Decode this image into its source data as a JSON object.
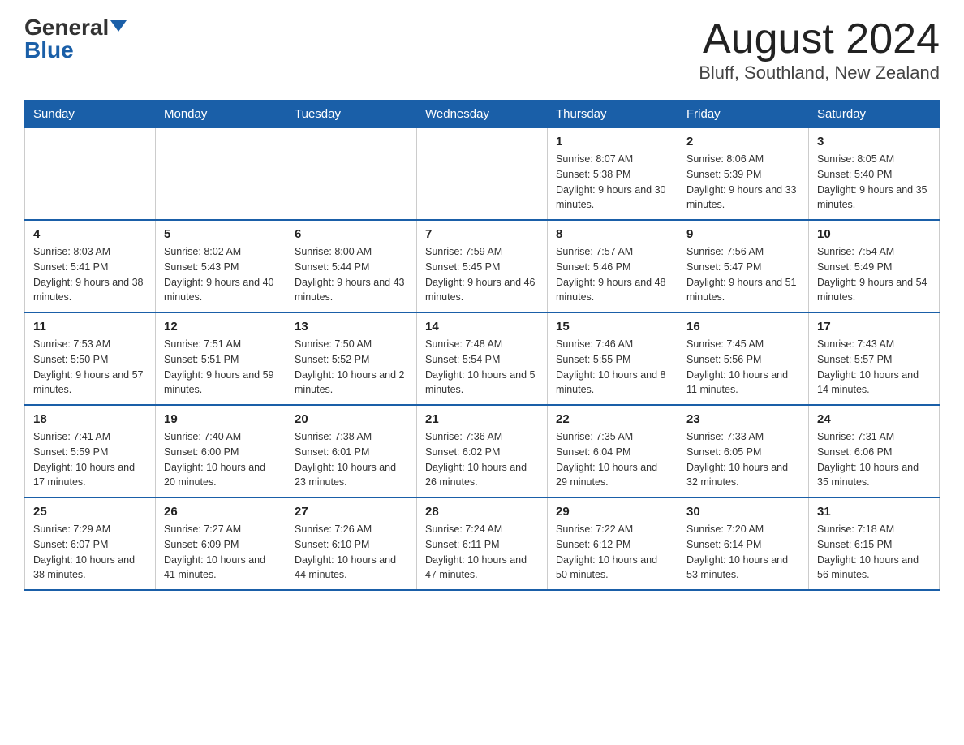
{
  "logo": {
    "general": "General",
    "blue": "Blue"
  },
  "title": "August 2024",
  "subtitle": "Bluff, Southland, New Zealand",
  "days_of_week": [
    "Sunday",
    "Monday",
    "Tuesday",
    "Wednesday",
    "Thursday",
    "Friday",
    "Saturday"
  ],
  "weeks": [
    [
      {
        "day": "",
        "info": ""
      },
      {
        "day": "",
        "info": ""
      },
      {
        "day": "",
        "info": ""
      },
      {
        "day": "",
        "info": ""
      },
      {
        "day": "1",
        "info": "Sunrise: 8:07 AM\nSunset: 5:38 PM\nDaylight: 9 hours and 30 minutes."
      },
      {
        "day": "2",
        "info": "Sunrise: 8:06 AM\nSunset: 5:39 PM\nDaylight: 9 hours and 33 minutes."
      },
      {
        "day": "3",
        "info": "Sunrise: 8:05 AM\nSunset: 5:40 PM\nDaylight: 9 hours and 35 minutes."
      }
    ],
    [
      {
        "day": "4",
        "info": "Sunrise: 8:03 AM\nSunset: 5:41 PM\nDaylight: 9 hours and 38 minutes."
      },
      {
        "day": "5",
        "info": "Sunrise: 8:02 AM\nSunset: 5:43 PM\nDaylight: 9 hours and 40 minutes."
      },
      {
        "day": "6",
        "info": "Sunrise: 8:00 AM\nSunset: 5:44 PM\nDaylight: 9 hours and 43 minutes."
      },
      {
        "day": "7",
        "info": "Sunrise: 7:59 AM\nSunset: 5:45 PM\nDaylight: 9 hours and 46 minutes."
      },
      {
        "day": "8",
        "info": "Sunrise: 7:57 AM\nSunset: 5:46 PM\nDaylight: 9 hours and 48 minutes."
      },
      {
        "day": "9",
        "info": "Sunrise: 7:56 AM\nSunset: 5:47 PM\nDaylight: 9 hours and 51 minutes."
      },
      {
        "day": "10",
        "info": "Sunrise: 7:54 AM\nSunset: 5:49 PM\nDaylight: 9 hours and 54 minutes."
      }
    ],
    [
      {
        "day": "11",
        "info": "Sunrise: 7:53 AM\nSunset: 5:50 PM\nDaylight: 9 hours and 57 minutes."
      },
      {
        "day": "12",
        "info": "Sunrise: 7:51 AM\nSunset: 5:51 PM\nDaylight: 9 hours and 59 minutes."
      },
      {
        "day": "13",
        "info": "Sunrise: 7:50 AM\nSunset: 5:52 PM\nDaylight: 10 hours and 2 minutes."
      },
      {
        "day": "14",
        "info": "Sunrise: 7:48 AM\nSunset: 5:54 PM\nDaylight: 10 hours and 5 minutes."
      },
      {
        "day": "15",
        "info": "Sunrise: 7:46 AM\nSunset: 5:55 PM\nDaylight: 10 hours and 8 minutes."
      },
      {
        "day": "16",
        "info": "Sunrise: 7:45 AM\nSunset: 5:56 PM\nDaylight: 10 hours and 11 minutes."
      },
      {
        "day": "17",
        "info": "Sunrise: 7:43 AM\nSunset: 5:57 PM\nDaylight: 10 hours and 14 minutes."
      }
    ],
    [
      {
        "day": "18",
        "info": "Sunrise: 7:41 AM\nSunset: 5:59 PM\nDaylight: 10 hours and 17 minutes."
      },
      {
        "day": "19",
        "info": "Sunrise: 7:40 AM\nSunset: 6:00 PM\nDaylight: 10 hours and 20 minutes."
      },
      {
        "day": "20",
        "info": "Sunrise: 7:38 AM\nSunset: 6:01 PM\nDaylight: 10 hours and 23 minutes."
      },
      {
        "day": "21",
        "info": "Sunrise: 7:36 AM\nSunset: 6:02 PM\nDaylight: 10 hours and 26 minutes."
      },
      {
        "day": "22",
        "info": "Sunrise: 7:35 AM\nSunset: 6:04 PM\nDaylight: 10 hours and 29 minutes."
      },
      {
        "day": "23",
        "info": "Sunrise: 7:33 AM\nSunset: 6:05 PM\nDaylight: 10 hours and 32 minutes."
      },
      {
        "day": "24",
        "info": "Sunrise: 7:31 AM\nSunset: 6:06 PM\nDaylight: 10 hours and 35 minutes."
      }
    ],
    [
      {
        "day": "25",
        "info": "Sunrise: 7:29 AM\nSunset: 6:07 PM\nDaylight: 10 hours and 38 minutes."
      },
      {
        "day": "26",
        "info": "Sunrise: 7:27 AM\nSunset: 6:09 PM\nDaylight: 10 hours and 41 minutes."
      },
      {
        "day": "27",
        "info": "Sunrise: 7:26 AM\nSunset: 6:10 PM\nDaylight: 10 hours and 44 minutes."
      },
      {
        "day": "28",
        "info": "Sunrise: 7:24 AM\nSunset: 6:11 PM\nDaylight: 10 hours and 47 minutes."
      },
      {
        "day": "29",
        "info": "Sunrise: 7:22 AM\nSunset: 6:12 PM\nDaylight: 10 hours and 50 minutes."
      },
      {
        "day": "30",
        "info": "Sunrise: 7:20 AM\nSunset: 6:14 PM\nDaylight: 10 hours and 53 minutes."
      },
      {
        "day": "31",
        "info": "Sunrise: 7:18 AM\nSunset: 6:15 PM\nDaylight: 10 hours and 56 minutes."
      }
    ]
  ]
}
